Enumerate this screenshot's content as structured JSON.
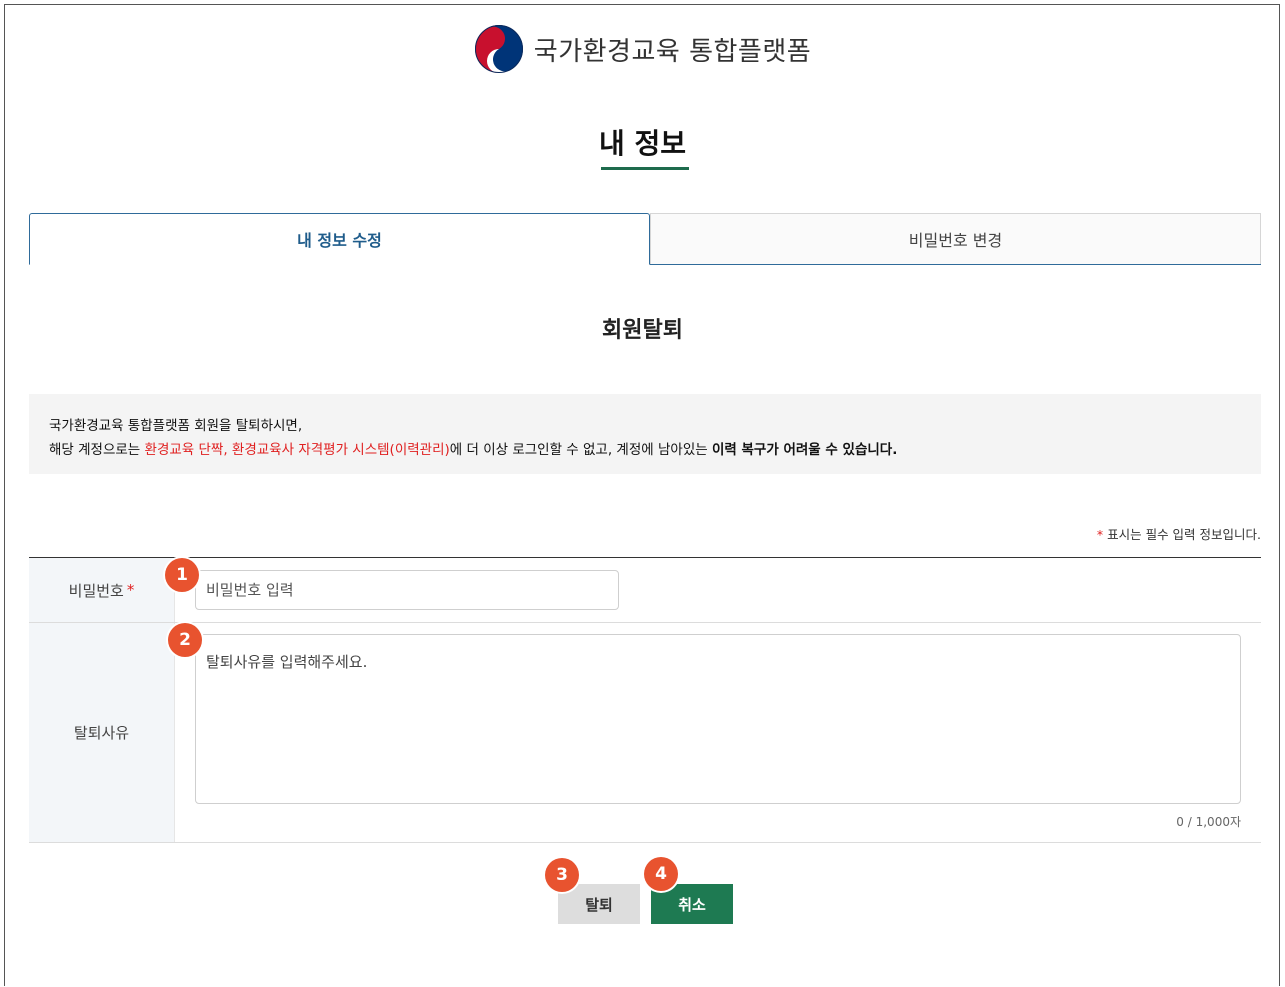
{
  "brand": {
    "name": "국가환경교육 통합플랫폼",
    "icon": "taegeuk-emblem-icon"
  },
  "page": {
    "title": "내 정보"
  },
  "tabs": [
    {
      "label": "내 정보 수정",
      "active": true
    },
    {
      "label": "비밀번호 변경",
      "active": false
    }
  ],
  "section": {
    "title": "회원탈퇴"
  },
  "notice": {
    "line1": "국가환경교육 통합플랫폼 회원을 탈퇴하시면,",
    "line2_prefix": "해당 계정으로는 ",
    "line2_red": "환경교육 단짝, 환경교육사 자격평가 시스템(이력관리)",
    "line2_middle": "에 더 이상 로그인할 수 없고, 계정에 남아있는 ",
    "line2_bold": "이력 복구가 어려울 수 있습니다."
  },
  "required_note": {
    "star": "*",
    "text": " 표시는 필수 입력 정보입니다."
  },
  "form": {
    "password": {
      "label": "비밀번호",
      "star": "*",
      "placeholder": "비밀번호 입력"
    },
    "reason": {
      "label": "탈퇴사유",
      "placeholder": "탈퇴사유를 입력해주세요.",
      "counter": "0 / 1,000자"
    }
  },
  "buttons": {
    "withdraw": "탈퇴",
    "cancel": "취소"
  },
  "badges": [
    "1",
    "2",
    "3",
    "4"
  ],
  "colors": {
    "accent_green": "#1e7a52",
    "tab_blue": "#1f5c8b",
    "badge_orange": "#e8532f",
    "required_red": "#e02020"
  }
}
